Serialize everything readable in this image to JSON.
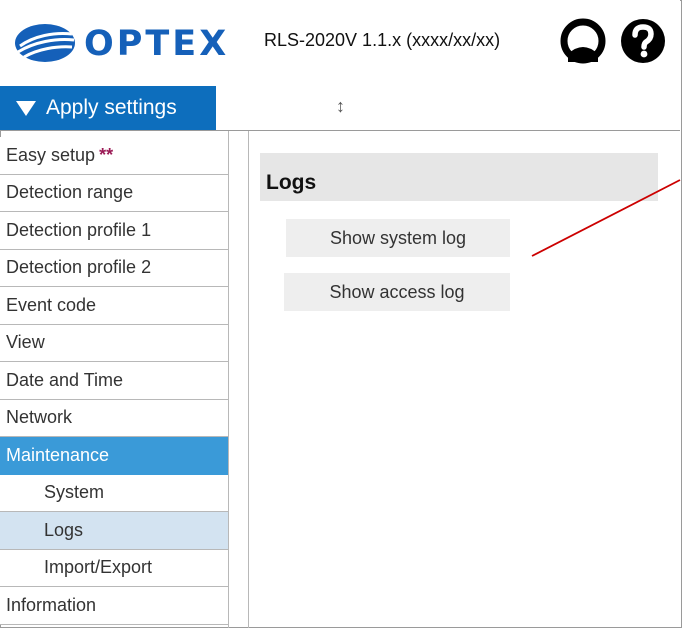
{
  "header": {
    "logo_text": "OPTEX",
    "version": "RLS-2020V 1.1.x (xxxx/xx/xx)",
    "user_icon": "user-circle-icon",
    "help_icon": "help-question-icon"
  },
  "toolbar": {
    "apply_label": "Apply settings",
    "resize_glyph": "↕"
  },
  "sidebar": {
    "items": [
      {
        "label": "Easy setup",
        "marker": "**"
      },
      {
        "label": "Detection range"
      },
      {
        "label": "Detection profile 1"
      },
      {
        "label": "Detection profile 2"
      },
      {
        "label": "Event code"
      },
      {
        "label": "View"
      },
      {
        "label": "Date and Time"
      },
      {
        "label": "Network"
      },
      {
        "label": "Maintenance"
      },
      {
        "label": "System"
      },
      {
        "label": "Logs"
      },
      {
        "label": "Import/Export"
      },
      {
        "label": "Information"
      }
    ]
  },
  "main": {
    "title": "Logs",
    "buttons": {
      "system_log": "Show system log",
      "access_log": "Show access log"
    }
  },
  "colors": {
    "brand": "#1560b9",
    "apply_bg": "#0d6ebd",
    "active_section": "#3a9ad8",
    "active_sub": "#d3e3f1",
    "marker": "#9b1b56",
    "annotation_line": "#cc0000"
  }
}
